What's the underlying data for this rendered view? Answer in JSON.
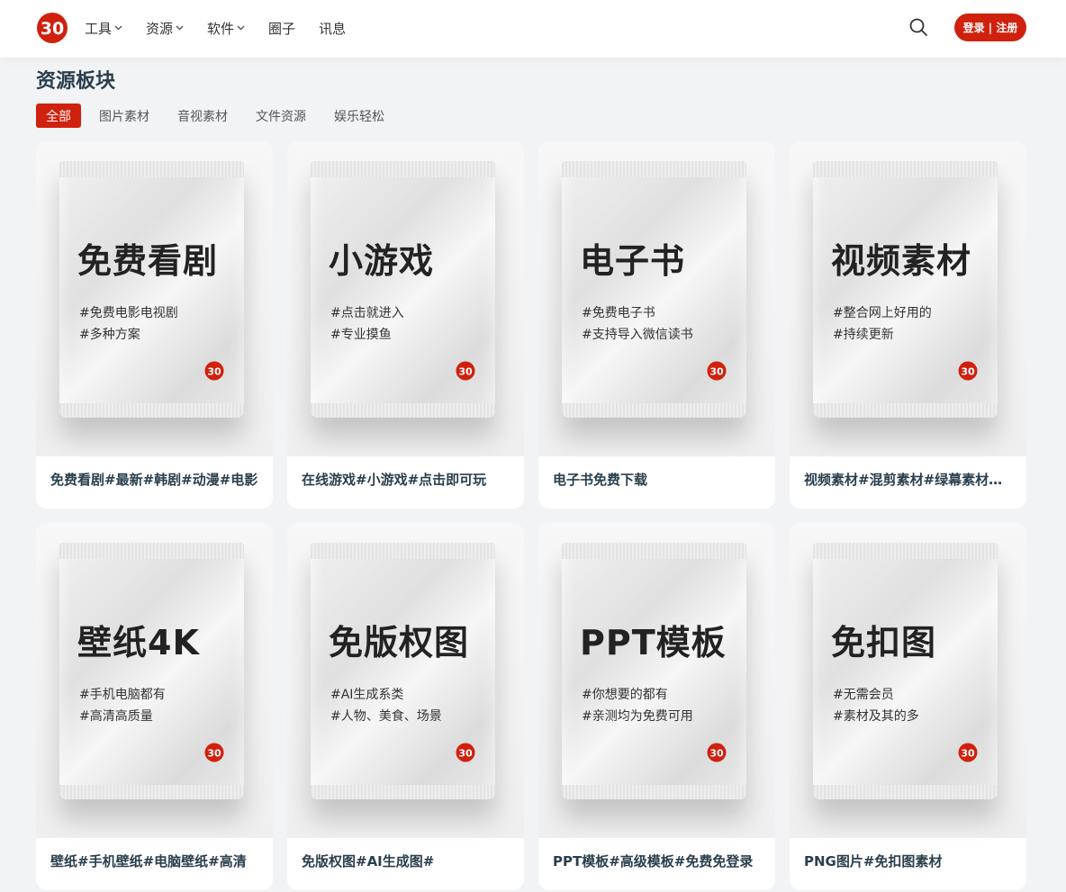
{
  "header": {
    "logo": {
      "icon": "brand-logo-icon",
      "color": "#d0210e"
    },
    "nav": [
      {
        "label": "工具",
        "dropdown": true
      },
      {
        "label": "资源",
        "dropdown": true
      },
      {
        "label": "软件",
        "dropdown": true
      },
      {
        "label": "圈子",
        "dropdown": false
      },
      {
        "label": "讯息",
        "dropdown": false
      }
    ],
    "search_icon": "search-icon",
    "login_label": "登录 | 注册"
  },
  "section": {
    "title": "资源板块",
    "tabs": [
      "全部",
      "图片素材",
      "音视素材",
      "文件资源",
      "娱乐轻松"
    ],
    "active_tab": "全部"
  },
  "cards": [
    {
      "bag_title": "免费看剧",
      "tags": [
        "#免费电影电视剧",
        "#多种方案"
      ],
      "title": "免费看剧#最新#韩剧#动漫#电影"
    },
    {
      "bag_title": "小游戏",
      "tags": [
        "#点击就进入",
        "#专业摸鱼"
      ],
      "title": "在线游戏#小游戏#点击即可玩"
    },
    {
      "bag_title": "电子书",
      "tags": [
        "#免费电子书",
        "#支持导入微信读书"
      ],
      "title": "电子书免费下载"
    },
    {
      "bag_title": "视频素材",
      "tags": [
        "#整合网上好用的",
        "#持续更新"
      ],
      "title": "视频素材#混剪素材#绿幕素材#特效"
    },
    {
      "bag_title": "壁纸4K",
      "tags": [
        "#手机电脑都有",
        "#高清高质量"
      ],
      "title": "壁纸#手机壁纸#电脑壁纸#高清"
    },
    {
      "bag_title": "免版权图",
      "tags": [
        "#AI生成系类",
        "#人物、美食、场景"
      ],
      "title": "免版权图#AI生成图#"
    },
    {
      "bag_title": "PPT模板",
      "tags": [
        "#你想要的都有",
        "#亲测均为免费可用"
      ],
      "title": "PPT模板#高级模板#免费免登录"
    },
    {
      "bag_title": "免扣图",
      "tags": [
        "#无需会员",
        "#素材及其的多"
      ],
      "title": "PNG图片#免扣图素材"
    }
  ],
  "colors": {
    "accent": "#d0210e",
    "title_text": "#2a3f4d",
    "page_bg": "#f2f3f5"
  }
}
